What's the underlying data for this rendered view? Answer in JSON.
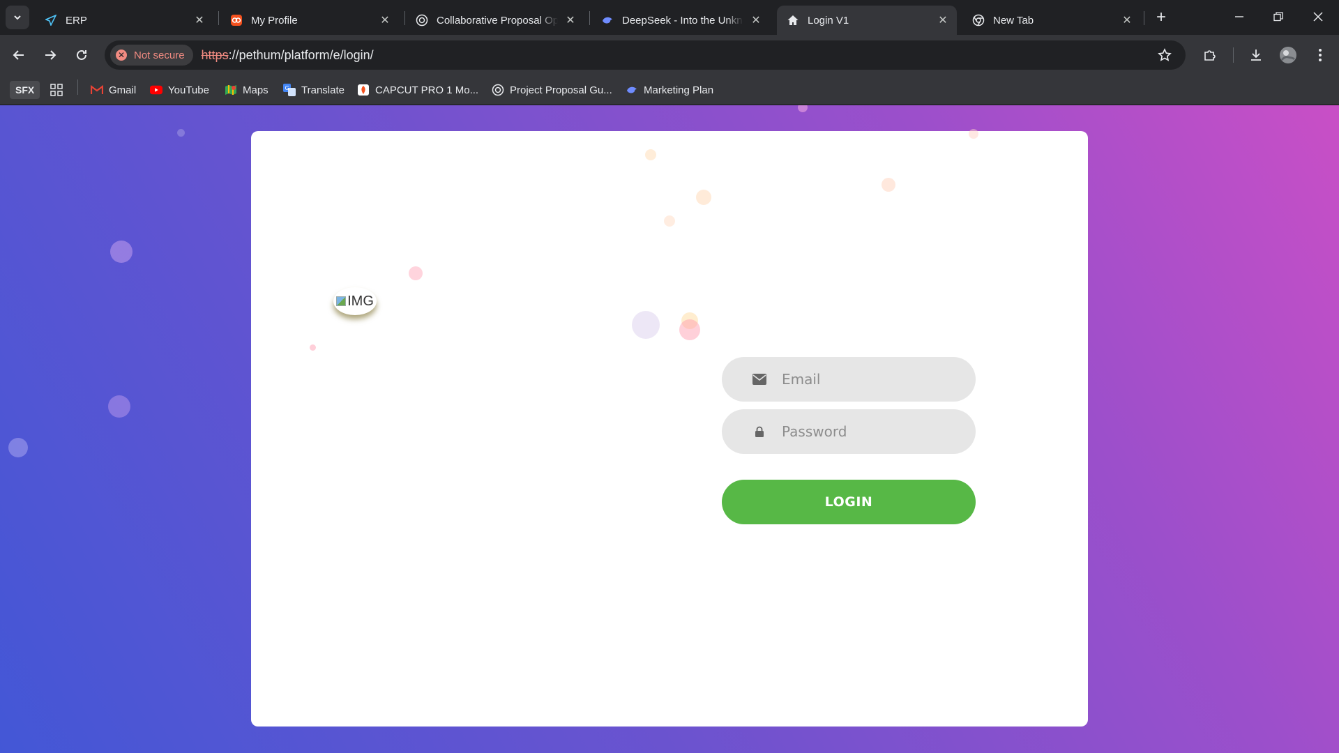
{
  "tabs": [
    {
      "title": "ERP",
      "icon": "paper-plane-icon",
      "active": false
    },
    {
      "title": "My Profile",
      "icon": "orange-app-icon",
      "active": false
    },
    {
      "title": "Collaborative Proposal Opt",
      "icon": "openai-icon",
      "active": false
    },
    {
      "title": "DeepSeek - Into the Unknown",
      "icon": "deepseek-whale-icon",
      "active": false
    },
    {
      "title": "Login V1",
      "icon": "home-icon",
      "active": true
    },
    {
      "title": "New Tab",
      "icon": "chrome-icon",
      "active": false
    }
  ],
  "toolbar": {
    "security_chip": "Not secure",
    "url_scheme": "https",
    "url_rest": "://pethum/platform/e/login/"
  },
  "bookmarks": [
    {
      "label": "SFX"
    },
    {
      "label": "Gmail",
      "icon": "gmail-icon"
    },
    {
      "label": "YouTube",
      "icon": "youtube-icon"
    },
    {
      "label": "Maps",
      "icon": "maps-icon"
    },
    {
      "label": "Translate",
      "icon": "translate-icon"
    },
    {
      "label": "CAPCUT PRO 1 Mo...",
      "icon": "capcut-icon"
    },
    {
      "label": "Project Proposal Gu...",
      "icon": "openai-icon"
    },
    {
      "label": "Marketing Plan",
      "icon": "deepseek-whale-icon"
    }
  ],
  "login": {
    "logo_alt": "IMG",
    "email_placeholder": "Email",
    "password_placeholder": "Password",
    "button_label": "LOGIN"
  },
  "colors": {
    "accent_green": "#57b846",
    "gradient_start": "#4357d6",
    "gradient_end": "#c94fc6",
    "not_secure": "#f28b82"
  }
}
